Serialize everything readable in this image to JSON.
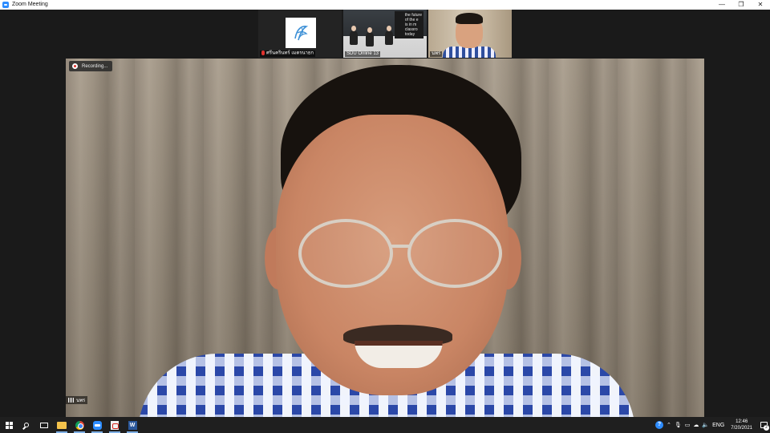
{
  "window": {
    "title": "Zoom Meeting",
    "controls": {
      "minimize": "—",
      "restore": "❐",
      "close": "✕"
    }
  },
  "gallery": {
    "tiles": [
      {
        "name": "ศรีนครินทร์ เมตรนายก",
        "muted": true
      },
      {
        "name": "SDU Online 13",
        "screen_text": "the future\nof the e\nis in m\nclassro\ntoday"
      },
      {
        "name": "นพร",
        "active": true
      }
    ]
  },
  "main_video": {
    "recording_label": "Recording...",
    "speaker_name": "นพร"
  },
  "taskbar": {
    "apps": [
      "start",
      "search",
      "task-view",
      "file-explorer",
      "chrome",
      "zoom",
      "acrobat",
      "word"
    ],
    "tray": {
      "language": "ENG",
      "time": "12:46",
      "date": "7/20/2021",
      "notification_count": "2"
    }
  },
  "colors": {
    "zoom_blue": "#2d8cff",
    "active_speaker": "#8bd14c",
    "recording_red": "#e0332e"
  }
}
